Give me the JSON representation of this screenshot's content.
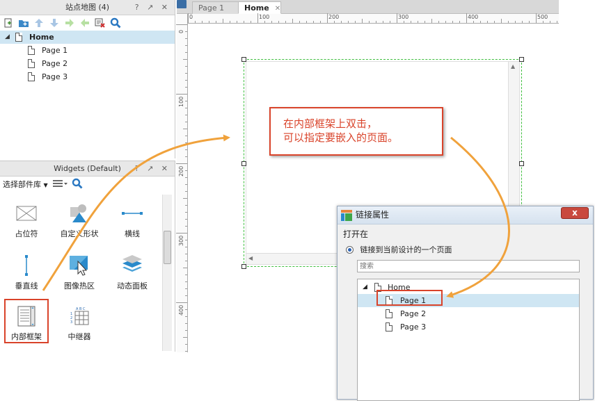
{
  "sitemap": {
    "title": "站点地图 (4)",
    "ctrls": [
      "?",
      "↗",
      "✕"
    ],
    "pages": [
      {
        "label": "Home",
        "level": 0,
        "selected": true
      },
      {
        "label": "Page 1",
        "level": 1
      },
      {
        "label": "Page 2",
        "level": 1
      },
      {
        "label": "Page 3",
        "level": 1
      }
    ]
  },
  "widgets": {
    "title": "Widgets (Default)",
    "library_selector": "选择部件库",
    "items": [
      {
        "label": "占位符",
        "icon": "placeholder-icon"
      },
      {
        "label": "自定义形状",
        "icon": "custom-shape-icon"
      },
      {
        "label": "横线",
        "icon": "horizontal-line-icon"
      },
      {
        "label": "垂直线",
        "icon": "vertical-line-icon"
      },
      {
        "label": "图像热区",
        "icon": "hotspot-icon"
      },
      {
        "label": "动态面板",
        "icon": "dynamic-panel-icon"
      },
      {
        "label": "内部框架",
        "icon": "inline-frame-icon"
      },
      {
        "label": "中继器",
        "icon": "repeater-icon"
      }
    ]
  },
  "tabs": [
    {
      "label": "Page 1",
      "active": false
    },
    {
      "label": "Home",
      "active": true
    }
  ],
  "ruler": {
    "h_labels": [
      "0",
      "100",
      "200",
      "300",
      "400",
      "500"
    ],
    "v_labels": [
      "0",
      "100",
      "200",
      "300",
      "400"
    ]
  },
  "callout": {
    "line1": "在内部框架上双击，",
    "line2": "可以指定要嵌入的页面。"
  },
  "link_dialog": {
    "title": "链接属性",
    "close_label": "x",
    "open_in_label": "打开在",
    "radio_label": "链接到当前设计的一个页面",
    "search_placeholder": "搜索",
    "tree": [
      {
        "label": "Home",
        "level": 0
      },
      {
        "label": "Page 1",
        "level": 1,
        "selected": true
      },
      {
        "label": "Page 2",
        "level": 1
      },
      {
        "label": "Page 3",
        "level": 1
      }
    ]
  },
  "colors": {
    "accent_red": "#d9432a",
    "arrow_orange": "#f0a23c",
    "selection_blue": "#cfe6f3",
    "frame_green": "#3fbf3f"
  }
}
